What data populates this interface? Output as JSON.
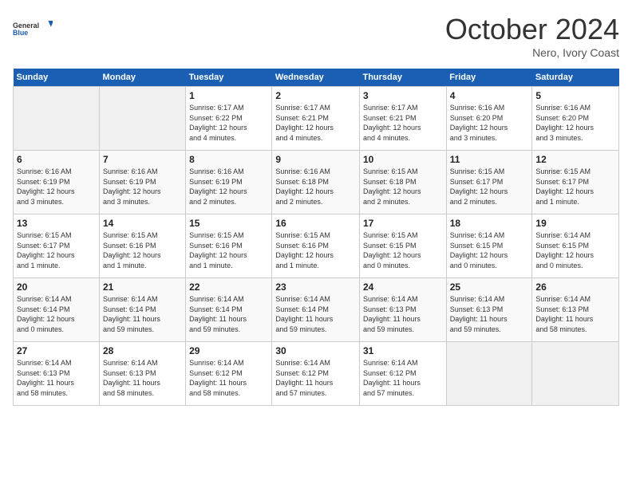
{
  "header": {
    "logo_general": "General",
    "logo_blue": "Blue",
    "month": "October 2024",
    "location": "Nero, Ivory Coast"
  },
  "days_of_week": [
    "Sunday",
    "Monday",
    "Tuesday",
    "Wednesday",
    "Thursday",
    "Friday",
    "Saturday"
  ],
  "weeks": [
    [
      {
        "day": "",
        "info": ""
      },
      {
        "day": "",
        "info": ""
      },
      {
        "day": "1",
        "info": "Sunrise: 6:17 AM\nSunset: 6:22 PM\nDaylight: 12 hours\nand 4 minutes."
      },
      {
        "day": "2",
        "info": "Sunrise: 6:17 AM\nSunset: 6:21 PM\nDaylight: 12 hours\nand 4 minutes."
      },
      {
        "day": "3",
        "info": "Sunrise: 6:17 AM\nSunset: 6:21 PM\nDaylight: 12 hours\nand 4 minutes."
      },
      {
        "day": "4",
        "info": "Sunrise: 6:16 AM\nSunset: 6:20 PM\nDaylight: 12 hours\nand 3 minutes."
      },
      {
        "day": "5",
        "info": "Sunrise: 6:16 AM\nSunset: 6:20 PM\nDaylight: 12 hours\nand 3 minutes."
      }
    ],
    [
      {
        "day": "6",
        "info": "Sunrise: 6:16 AM\nSunset: 6:19 PM\nDaylight: 12 hours\nand 3 minutes."
      },
      {
        "day": "7",
        "info": "Sunrise: 6:16 AM\nSunset: 6:19 PM\nDaylight: 12 hours\nand 3 minutes."
      },
      {
        "day": "8",
        "info": "Sunrise: 6:16 AM\nSunset: 6:19 PM\nDaylight: 12 hours\nand 2 minutes."
      },
      {
        "day": "9",
        "info": "Sunrise: 6:16 AM\nSunset: 6:18 PM\nDaylight: 12 hours\nand 2 minutes."
      },
      {
        "day": "10",
        "info": "Sunrise: 6:15 AM\nSunset: 6:18 PM\nDaylight: 12 hours\nand 2 minutes."
      },
      {
        "day": "11",
        "info": "Sunrise: 6:15 AM\nSunset: 6:17 PM\nDaylight: 12 hours\nand 2 minutes."
      },
      {
        "day": "12",
        "info": "Sunrise: 6:15 AM\nSunset: 6:17 PM\nDaylight: 12 hours\nand 1 minute."
      }
    ],
    [
      {
        "day": "13",
        "info": "Sunrise: 6:15 AM\nSunset: 6:17 PM\nDaylight: 12 hours\nand 1 minute."
      },
      {
        "day": "14",
        "info": "Sunrise: 6:15 AM\nSunset: 6:16 PM\nDaylight: 12 hours\nand 1 minute."
      },
      {
        "day": "15",
        "info": "Sunrise: 6:15 AM\nSunset: 6:16 PM\nDaylight: 12 hours\nand 1 minute."
      },
      {
        "day": "16",
        "info": "Sunrise: 6:15 AM\nSunset: 6:16 PM\nDaylight: 12 hours\nand 1 minute."
      },
      {
        "day": "17",
        "info": "Sunrise: 6:15 AM\nSunset: 6:15 PM\nDaylight: 12 hours\nand 0 minutes."
      },
      {
        "day": "18",
        "info": "Sunrise: 6:14 AM\nSunset: 6:15 PM\nDaylight: 12 hours\nand 0 minutes."
      },
      {
        "day": "19",
        "info": "Sunrise: 6:14 AM\nSunset: 6:15 PM\nDaylight: 12 hours\nand 0 minutes."
      }
    ],
    [
      {
        "day": "20",
        "info": "Sunrise: 6:14 AM\nSunset: 6:14 PM\nDaylight: 12 hours\nand 0 minutes."
      },
      {
        "day": "21",
        "info": "Sunrise: 6:14 AM\nSunset: 6:14 PM\nDaylight: 11 hours\nand 59 minutes."
      },
      {
        "day": "22",
        "info": "Sunrise: 6:14 AM\nSunset: 6:14 PM\nDaylight: 11 hours\nand 59 minutes."
      },
      {
        "day": "23",
        "info": "Sunrise: 6:14 AM\nSunset: 6:14 PM\nDaylight: 11 hours\nand 59 minutes."
      },
      {
        "day": "24",
        "info": "Sunrise: 6:14 AM\nSunset: 6:13 PM\nDaylight: 11 hours\nand 59 minutes."
      },
      {
        "day": "25",
        "info": "Sunrise: 6:14 AM\nSunset: 6:13 PM\nDaylight: 11 hours\nand 59 minutes."
      },
      {
        "day": "26",
        "info": "Sunrise: 6:14 AM\nSunset: 6:13 PM\nDaylight: 11 hours\nand 58 minutes."
      }
    ],
    [
      {
        "day": "27",
        "info": "Sunrise: 6:14 AM\nSunset: 6:13 PM\nDaylight: 11 hours\nand 58 minutes."
      },
      {
        "day": "28",
        "info": "Sunrise: 6:14 AM\nSunset: 6:13 PM\nDaylight: 11 hours\nand 58 minutes."
      },
      {
        "day": "29",
        "info": "Sunrise: 6:14 AM\nSunset: 6:12 PM\nDaylight: 11 hours\nand 58 minutes."
      },
      {
        "day": "30",
        "info": "Sunrise: 6:14 AM\nSunset: 6:12 PM\nDaylight: 11 hours\nand 57 minutes."
      },
      {
        "day": "31",
        "info": "Sunrise: 6:14 AM\nSunset: 6:12 PM\nDaylight: 11 hours\nand 57 minutes."
      },
      {
        "day": "",
        "info": ""
      },
      {
        "day": "",
        "info": ""
      }
    ]
  ]
}
